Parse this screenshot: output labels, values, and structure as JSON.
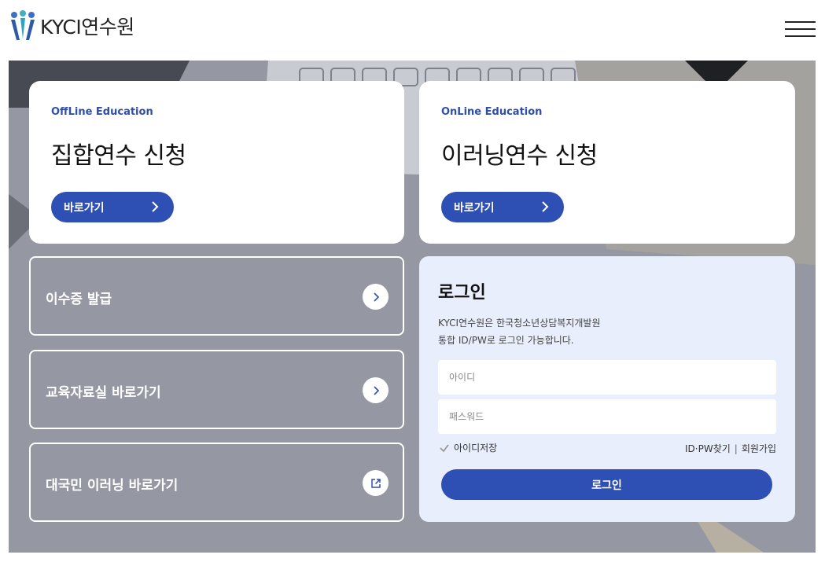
{
  "header": {
    "logo_text": "KYCI연수원",
    "menu_icon": "hamburger-menu-icon"
  },
  "cards": {
    "offline": {
      "eyebrow": "OffLine Education",
      "title": "집합연수 신청",
      "button_label": "바로가기"
    },
    "online": {
      "eyebrow": "OnLine Education",
      "title": "이러닝연수 신청",
      "button_label": "바로가기"
    }
  },
  "links": [
    {
      "label": "이수증 발급",
      "icon": "chevron-right-icon"
    },
    {
      "label": "교육자료실 바로가기",
      "icon": "chevron-right-icon"
    },
    {
      "label": "대국민 이러닝 바로가기",
      "icon": "external-link-icon"
    }
  ],
  "login": {
    "title": "로그인",
    "desc_line1": "KYCI연수원은 한국청소년상담복지개발원",
    "desc_line2": "통합 ID/PW로 로그인 가능합니다.",
    "id_placeholder": "아이디",
    "pw_placeholder": "패스워드",
    "save_id_label": "아이디저장",
    "find_label": "ID·PW찾기",
    "separator": "|",
    "signup_label": "회원가입",
    "submit_label": "로그인"
  },
  "colors": {
    "brand_blue": "#2e4fb4",
    "eyebrow_blue": "#2e4fa8",
    "login_panel_bg": "#e9eefc"
  }
}
